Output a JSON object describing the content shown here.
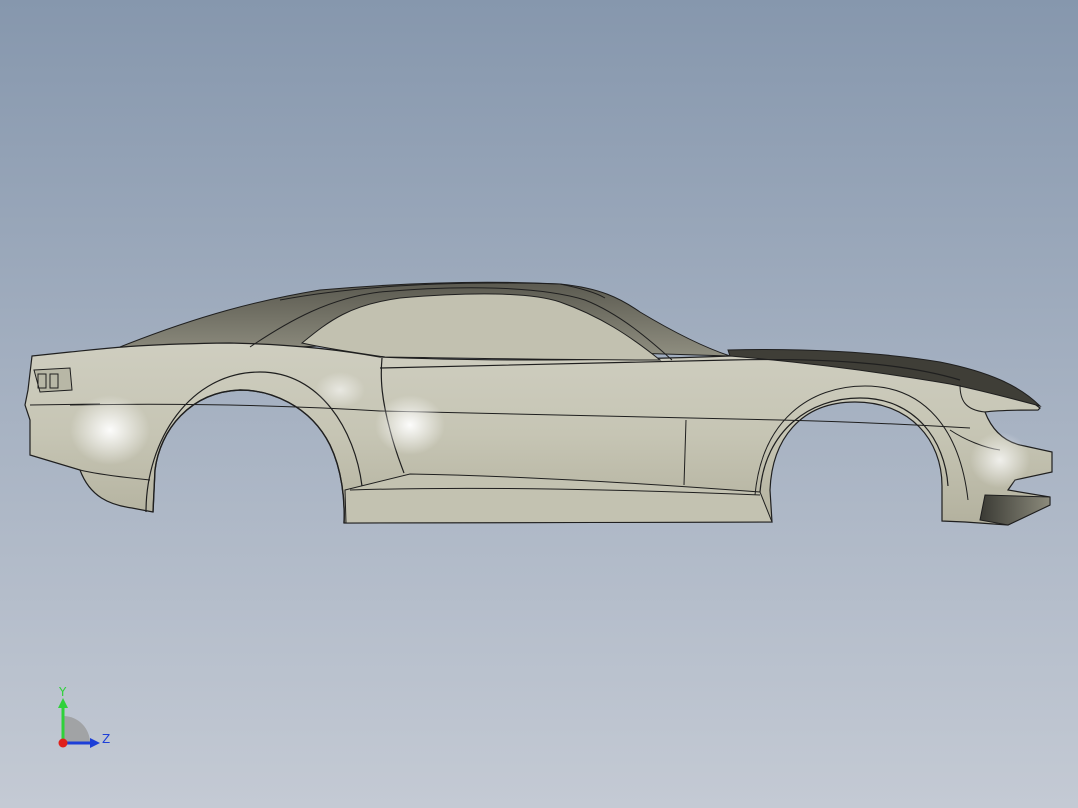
{
  "viewport": {
    "background_top": "#8697ad",
    "background_bottom": "#c4cad4"
  },
  "model": {
    "name": "car-body-side-view",
    "surface_color": "#c9c8b9",
    "edge_color": "#1f1f1f"
  },
  "triad": {
    "y_label": "Y",
    "z_label": "Z",
    "y_color": "#2fd13a",
    "z_color": "#1d3fd8",
    "x_color": "#e0201b"
  }
}
